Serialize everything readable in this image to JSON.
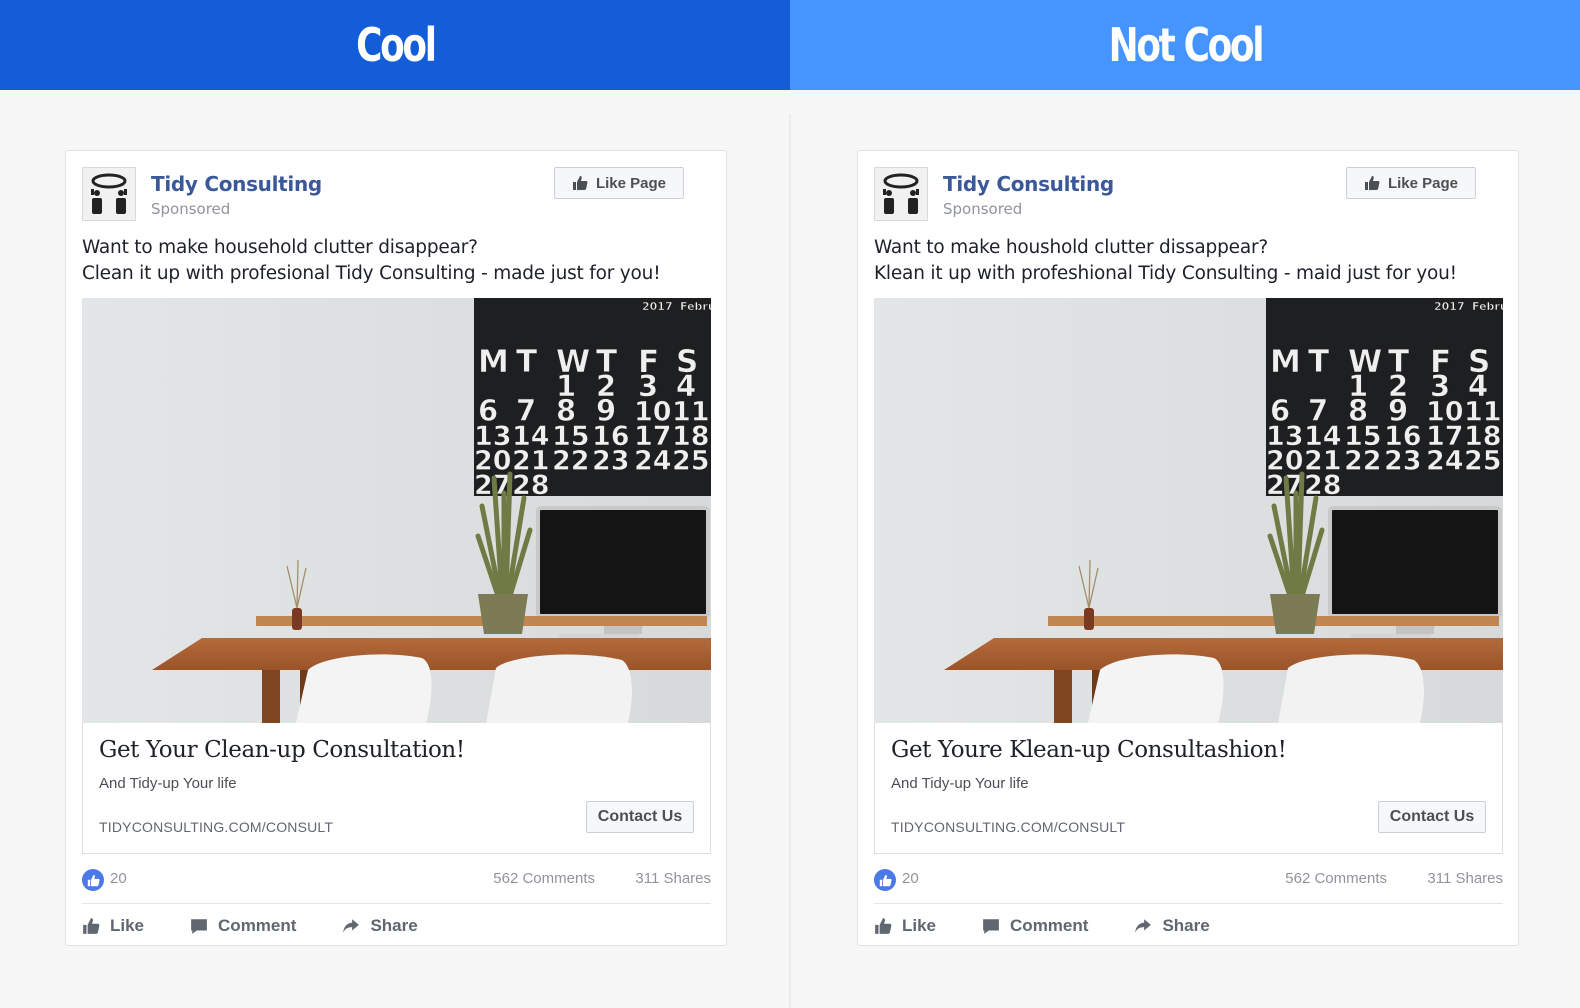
{
  "banners": {
    "left": "Cool",
    "right": "Not Cool",
    "left_color": "#135ed8",
    "right_color": "#4594ff"
  },
  "ads": [
    {
      "page_name": "Tidy Consulting",
      "sponsored": "Sponsored",
      "like_page_label": "Like Page",
      "text_line1": "Want to make household clutter disappear?",
      "text_line2": "Clean it up with profesional Tidy Consulting - made just for you!",
      "headline": "Get Your Clean-up Consultation!",
      "description": "And Tidy-up Your life",
      "domain": "TIDYCONSULTING.COM/CONSULT",
      "cta_label": "Contact Us",
      "like_count": "20",
      "comments": "562 Comments",
      "shares": "311 Shares",
      "actions": {
        "like": "Like",
        "comment": "Comment",
        "share": "Share"
      },
      "calendar": {
        "year": "2017",
        "month": "Febru",
        "days": [
          "M",
          "T",
          "W",
          "T",
          "F",
          "S"
        ],
        "rows": [
          [
            "",
            "",
            "1",
            "2",
            "3",
            "4"
          ],
          [
            "6",
            "7",
            "8",
            "9",
            "10",
            "11"
          ],
          [
            "13",
            "14",
            "15",
            "16",
            "17",
            "18"
          ],
          [
            "20",
            "21",
            "22",
            "23",
            "24",
            "25"
          ],
          [
            "27",
            "28",
            "",
            "",
            "",
            ""
          ]
        ]
      }
    },
    {
      "page_name": "Tidy Consulting",
      "sponsored": "Sponsored",
      "like_page_label": "Like Page",
      "text_line1": "Want to make houshold clutter dissappear?",
      "text_line2": "Klean it up with profeshional Tidy Consulting - maid just for you!",
      "headline": "Get Youre Klean-up Consultashion!",
      "description": "And Tidy-up Your life",
      "domain": "TIDYCONSULTING.COM/CONSULT",
      "cta_label": "Contact Us",
      "like_count": "20",
      "comments": "562 Comments",
      "shares": "311 Shares",
      "actions": {
        "like": "Like",
        "comment": "Comment",
        "share": "Share"
      },
      "calendar": {
        "year": "2017",
        "month": "Febru",
        "days": [
          "M",
          "T",
          "W",
          "T",
          "F",
          "S"
        ],
        "rows": [
          [
            "",
            "",
            "1",
            "2",
            "3",
            "4"
          ],
          [
            "6",
            "7",
            "8",
            "9",
            "10",
            "11"
          ],
          [
            "13",
            "14",
            "15",
            "16",
            "17",
            "18"
          ],
          [
            "20",
            "21",
            "22",
            "23",
            "24",
            "25"
          ],
          [
            "27",
            "28",
            "",
            "",
            "",
            ""
          ]
        ]
      }
    }
  ]
}
